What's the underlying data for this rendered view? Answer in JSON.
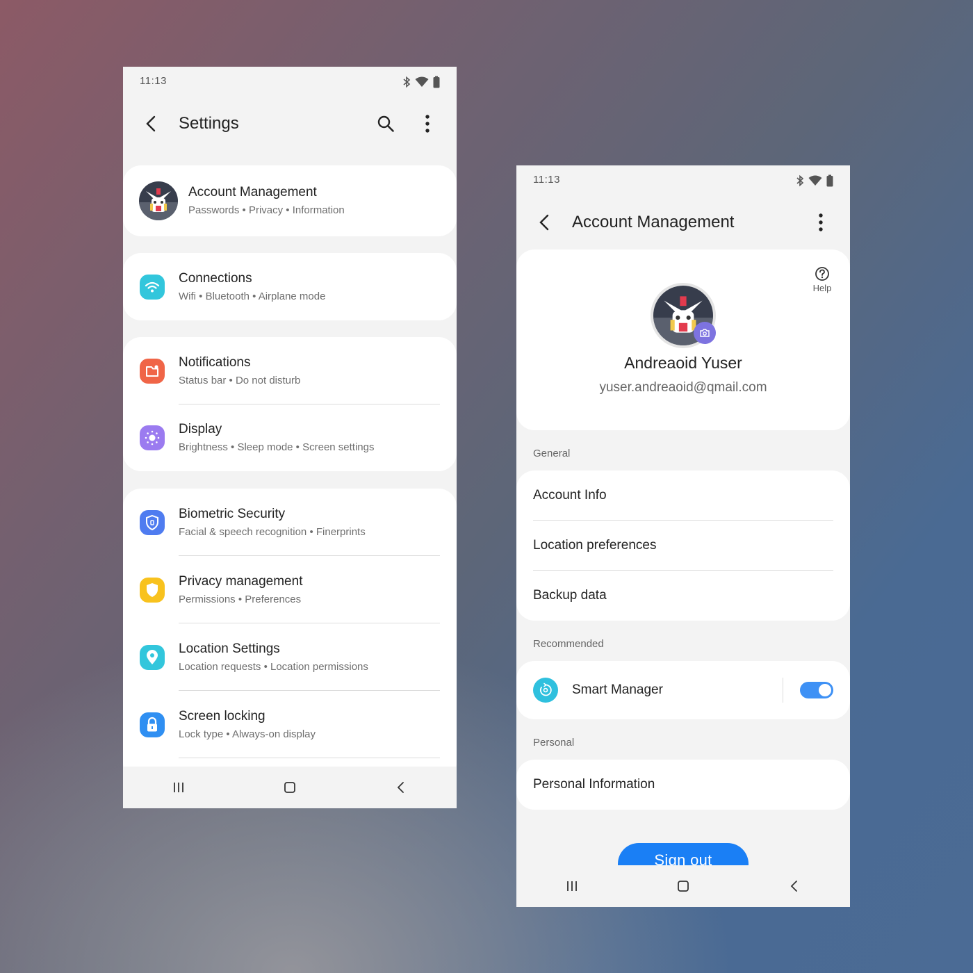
{
  "colors": {
    "connections": "#32c6dc",
    "notifications": "#f06547",
    "display": "#9b7bf0",
    "biometric": "#4f7cf0",
    "privacy": "#f8c21e",
    "location": "#32c6dc",
    "screen_lock": "#2f8ff2",
    "smart_manager": "#2fc0de",
    "toggle_on": "#3e91f5",
    "sign_out": "#1a7ff5"
  },
  "settings_screen": {
    "status_bar": {
      "time": "11:13",
      "icons": [
        "bluetooth-icon",
        "wifi-icon",
        "battery-icon"
      ]
    },
    "app_bar": {
      "title": "Settings",
      "icons": [
        "back-icon",
        "search-icon",
        "more-vert-icon"
      ]
    },
    "account": {
      "title": "Account Management",
      "subtitle": "Passwords • Privacy • Information",
      "icon": "robot-avatar"
    },
    "groups": [
      [
        {
          "title": "Connections",
          "subtitle": "Wifi • Bluetooth • Airplane mode",
          "icon": "wifi-icon"
        }
      ],
      [
        {
          "title": "Notifications",
          "subtitle": "Status bar • Do not disturb",
          "icon": "notification-icon"
        },
        {
          "title": "Display",
          "subtitle": "Brightness • Sleep mode • Screen settings",
          "icon": "brightness-icon"
        }
      ],
      [
        {
          "title": "Biometric Security",
          "subtitle": "Facial & speech recognition • Finerprints",
          "icon": "shield-icon"
        },
        {
          "title": "Privacy management",
          "subtitle": "Permissions • Preferences",
          "icon": "privacy-shield-icon"
        },
        {
          "title": "Location Settings",
          "subtitle": "Location requests • Location permissions",
          "icon": "location-pin-icon"
        },
        {
          "title": "Screen locking",
          "subtitle": "Lock type • Always-on display",
          "icon": "lock-icon"
        }
      ]
    ],
    "nav_bar": [
      "recents-icon",
      "home-icon",
      "back-icon"
    ]
  },
  "account_screen": {
    "status_bar": {
      "time": "11:13"
    },
    "app_bar": {
      "title": "Account Management"
    },
    "help_label": "Help",
    "profile": {
      "name": "Andreaoid Yuser",
      "email": "yuser.andreaoid@qmail.com"
    },
    "general": {
      "header": "General",
      "items": [
        "Account Info",
        "Location preferences",
        "Backup data"
      ]
    },
    "recommended": {
      "header": "Recommended",
      "item": "Smart Manager",
      "toggle_on": true
    },
    "personal": {
      "header": "Personal",
      "item": "Personal Information"
    },
    "sign_out_label": "Sign out"
  }
}
